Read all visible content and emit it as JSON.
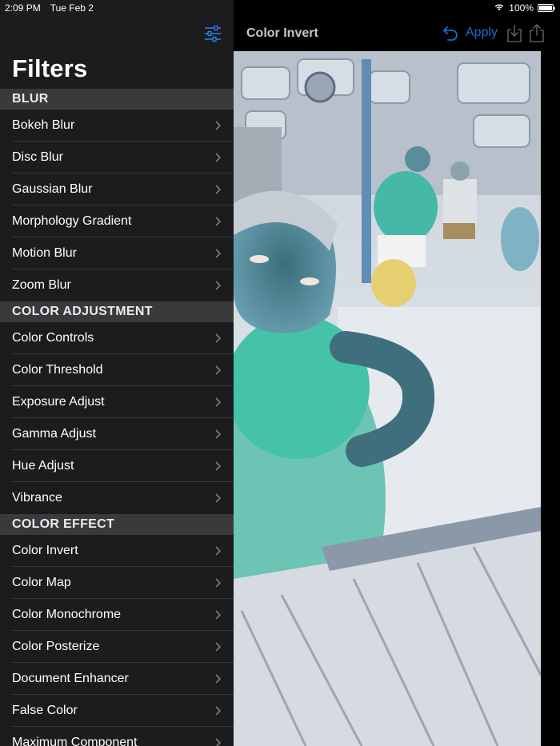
{
  "status": {
    "time": "2:09 PM",
    "date": "Tue Feb 2",
    "battery": "100%"
  },
  "sidebar": {
    "title": "Filters",
    "sections": [
      {
        "header": "BLUR",
        "items": [
          "Bokeh Blur",
          "Disc Blur",
          "Gaussian Blur",
          "Morphology Gradient",
          "Motion Blur",
          "Zoom Blur"
        ]
      },
      {
        "header": "COLOR ADJUSTMENT",
        "items": [
          "Color Controls",
          "Color Threshold",
          "Exposure Adjust",
          "Gamma Adjust",
          "Hue Adjust",
          "Vibrance"
        ]
      },
      {
        "header": "COLOR EFFECT",
        "items": [
          "Color Invert",
          "Color Map",
          "Color Monochrome",
          "Color Posterize",
          "Document Enhancer",
          "False Color",
          "Maximum Component"
        ]
      }
    ]
  },
  "editor": {
    "title": "Color Invert",
    "apply_label": "Apply"
  },
  "colors": {
    "accent": "#1d6bd0",
    "sidebar_bg": "#1c1c1e",
    "section_bg": "#3a3a3c"
  }
}
